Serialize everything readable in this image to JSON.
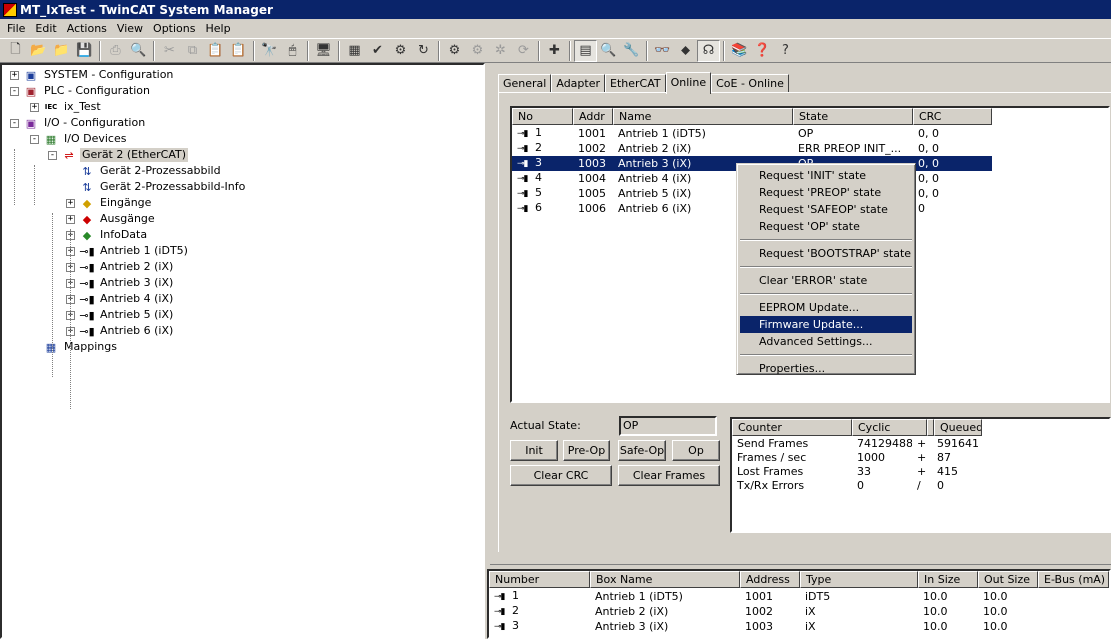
{
  "window": {
    "title": "MT_IxTest - TwinCAT System Manager"
  },
  "menu": [
    "File",
    "Edit",
    "Actions",
    "View",
    "Options",
    "Help"
  ],
  "toolbar": {
    "buttons": [
      {
        "name": "new-file-icon",
        "glyph": "🗋",
        "state": "normal"
      },
      {
        "name": "open-folder-icon",
        "glyph": "📂",
        "state": "normal"
      },
      {
        "name": "open-project-icon",
        "glyph": "📁",
        "state": "normal"
      },
      {
        "name": "save-icon",
        "glyph": "💾",
        "state": "normal"
      },
      {
        "sep": true
      },
      {
        "name": "print-icon",
        "glyph": "⎙",
        "state": "disabled"
      },
      {
        "name": "print-preview-icon",
        "glyph": "🔍",
        "state": "disabled"
      },
      {
        "sep": true
      },
      {
        "name": "cut-icon",
        "glyph": "✂",
        "state": "disabled"
      },
      {
        "name": "copy-icon",
        "glyph": "⧉",
        "state": "disabled"
      },
      {
        "name": "paste-icon",
        "glyph": "📋",
        "state": "disabled"
      },
      {
        "name": "paste-with-links-icon",
        "glyph": "📋",
        "state": "disabled"
      },
      {
        "sep": true
      },
      {
        "name": "find-icon",
        "glyph": "🔭",
        "state": "normal"
      },
      {
        "name": "find-next-icon",
        "glyph": "🖱",
        "state": "normal"
      },
      {
        "sep": true
      },
      {
        "name": "choose-target-icon",
        "glyph": "🖥",
        "state": "normal"
      },
      {
        "sep": true
      },
      {
        "name": "generate-mappings-icon",
        "glyph": "▦",
        "state": "normal"
      },
      {
        "name": "check-configuration-icon",
        "glyph": "✔",
        "state": "normal"
      },
      {
        "name": "activate-configuration-icon",
        "glyph": "⚙",
        "state": "normal"
      },
      {
        "name": "restart-icon",
        "glyph": "↻",
        "state": "normal"
      },
      {
        "sep": true
      },
      {
        "name": "config-mode-icon",
        "glyph": "⚙",
        "state": "normal"
      },
      {
        "name": "free-run-icon",
        "glyph": "⚙",
        "state": "disabled"
      },
      {
        "name": "toggle-run-icon",
        "glyph": "✲",
        "state": "disabled"
      },
      {
        "name": "reload-devices-icon",
        "glyph": "⟳",
        "state": "disabled"
      },
      {
        "sep": true
      },
      {
        "name": "scan-devices-icon",
        "glyph": "✚",
        "state": "normal"
      },
      {
        "sep": true
      },
      {
        "name": "show-online-data-icon",
        "glyph": "▤",
        "state": "pressed"
      },
      {
        "name": "zoom-icon",
        "glyph": "🔍",
        "state": "normal"
      },
      {
        "name": "scope-view-icon",
        "glyph": "🔧",
        "state": "normal"
      },
      {
        "sep": true
      },
      {
        "name": "watch-icon",
        "glyph": "👓",
        "state": "normal"
      },
      {
        "name": "force-icon",
        "glyph": "⬥",
        "state": "normal"
      },
      {
        "name": "online-watch-icon",
        "glyph": "☊",
        "state": "pressed"
      },
      {
        "sep": true
      },
      {
        "name": "books-icon",
        "glyph": "📚",
        "state": "normal"
      },
      {
        "name": "help-topics-icon",
        "glyph": "❓",
        "state": "normal"
      },
      {
        "name": "context-help-icon",
        "glyph": "?",
        "state": "normal"
      }
    ]
  },
  "tree": {
    "nodes": [
      {
        "label": "SYSTEM - Configuration",
        "level": 0,
        "expander": "+",
        "icon": "system-config-icon",
        "glyph": "▣",
        "color": "#1a3c9a"
      },
      {
        "label": "PLC - Configuration",
        "level": 0,
        "expander": "-",
        "icon": "plc-config-icon",
        "glyph": "▣",
        "color": "#a0222e"
      },
      {
        "label": "ix_Test",
        "level": 1,
        "expander": "+",
        "icon": "iec-project-icon",
        "glyph": "IEC",
        "color": "#000"
      },
      {
        "label": "I/O - Configuration",
        "level": 0,
        "expander": "-",
        "icon": "io-config-icon",
        "glyph": "▣",
        "color": "#7a2a9a"
      },
      {
        "label": "I/O Devices",
        "level": 1,
        "expander": "-",
        "icon": "io-devices-icon",
        "glyph": "▦",
        "color": "#2a7a2a"
      },
      {
        "label": "Gerät 2 (EtherCAT)",
        "level": 2,
        "expander": "-",
        "icon": "ethercat-device-icon",
        "glyph": "⇌",
        "color": "#c00",
        "selected": true
      },
      {
        "label": "Gerät 2-Prozessabbild",
        "level": 3,
        "expander": "",
        "icon": "process-image-icon",
        "glyph": "⇅",
        "color": "#1a3c9a"
      },
      {
        "label": "Gerät 2-Prozessabbild-Info",
        "level": 3,
        "expander": "",
        "icon": "process-image-info-icon",
        "glyph": "⇅",
        "color": "#1a3c9a"
      },
      {
        "label": "Eingänge",
        "level": 3,
        "expander": "+",
        "icon": "inputs-icon",
        "glyph": "◆",
        "color": "#d0a000"
      },
      {
        "label": "Ausgänge",
        "level": 3,
        "expander": "+",
        "icon": "outputs-icon",
        "glyph": "◆",
        "color": "#c00"
      },
      {
        "label": "InfoData",
        "level": 3,
        "expander": "+",
        "icon": "infodata-icon",
        "glyph": "◆",
        "color": "#2a8a2a"
      },
      {
        "label": "Antrieb 1 (iDT5)",
        "level": 3,
        "expander": "+",
        "icon": "drive-icon",
        "glyph": "⊸▮",
        "color": "#000"
      },
      {
        "label": "Antrieb 2 (iX)",
        "level": 3,
        "expander": "+",
        "icon": "drive-icon",
        "glyph": "⊸▮",
        "color": "#000"
      },
      {
        "label": "Antrieb 3 (iX)",
        "level": 3,
        "expander": "+",
        "icon": "drive-icon",
        "glyph": "⊸▮",
        "color": "#000"
      },
      {
        "label": "Antrieb 4 (iX)",
        "level": 3,
        "expander": "+",
        "icon": "drive-icon",
        "glyph": "⊸▮",
        "color": "#000"
      },
      {
        "label": "Antrieb 5 (iX)",
        "level": 3,
        "expander": "+",
        "icon": "drive-icon",
        "glyph": "⊸▮",
        "color": "#000"
      },
      {
        "label": "Antrieb 6 (iX)",
        "level": 3,
        "expander": "+",
        "icon": "drive-icon",
        "glyph": "⊸▮",
        "color": "#000"
      },
      {
        "label": "Mappings",
        "level": 1,
        "expander": "",
        "icon": "mappings-icon",
        "glyph": "▦",
        "color": "#1a3c9a"
      }
    ]
  },
  "tabs": [
    {
      "label": "General",
      "active": false
    },
    {
      "label": "Adapter",
      "active": false
    },
    {
      "label": "EtherCAT",
      "active": false
    },
    {
      "label": "Online",
      "active": true
    },
    {
      "label": "CoE - Online",
      "active": false
    }
  ],
  "slaves": {
    "columns": [
      "No",
      "Addr",
      "Name",
      "State",
      "CRC"
    ],
    "rows": [
      {
        "no": "1",
        "addr": "1001",
        "name": "Antrieb 1 (iDT5)",
        "state": "OP",
        "crc": "0, 0",
        "selected": false
      },
      {
        "no": "2",
        "addr": "1002",
        "name": "Antrieb 2 (iX)",
        "state": "ERR PREOP INIT_...",
        "crc": "0, 0",
        "selected": false
      },
      {
        "no": "3",
        "addr": "1003",
        "name": "Antrieb 3 (iX)",
        "state": "OP",
        "crc": "0, 0",
        "selected": true
      },
      {
        "no": "4",
        "addr": "1004",
        "name": "Antrieb 4 (iX)",
        "state": "",
        "crc": "0, 0",
        "selected": false
      },
      {
        "no": "5",
        "addr": "1005",
        "name": "Antrieb 5 (iX)",
        "state": "",
        "crc": "0, 0",
        "selected": false
      },
      {
        "no": "6",
        "addr": "1006",
        "name": "Antrieb 6 (iX)",
        "state": "",
        "crc": "0",
        "selected": false
      }
    ]
  },
  "context_menu": {
    "items": [
      {
        "label": "Request 'INIT' state"
      },
      {
        "label": "Request 'PREOP' state"
      },
      {
        "label": "Request 'SAFEOP' state"
      },
      {
        "label": "Request 'OP' state"
      },
      {
        "sep": true
      },
      {
        "label": "Request 'BOOTSTRAP' state"
      },
      {
        "sep": true
      },
      {
        "label": "Clear 'ERROR' state"
      },
      {
        "sep": true
      },
      {
        "label": "EEPROM Update..."
      },
      {
        "label": "Firmware Update...",
        "highlight": true
      },
      {
        "label": "Advanced Settings..."
      },
      {
        "sep": true
      },
      {
        "label": "Properties..."
      }
    ]
  },
  "state_panel": {
    "actual_state_label": "Actual State:",
    "actual_state_value": "OP",
    "buttons": {
      "init": "Init",
      "preop": "Pre-Op",
      "safeop": "Safe-Op",
      "op": "Op",
      "clear_crc": "Clear CRC",
      "clear_frames": "Clear Frames"
    }
  },
  "counters": {
    "columns": [
      "Counter",
      "Cyclic",
      "",
      "Queued"
    ],
    "rows": [
      {
        "counter": "Send Frames",
        "cyclic": "74129488",
        "op": "+",
        "queued": "591641"
      },
      {
        "counter": "Frames / sec",
        "cyclic": "1000",
        "op": "+",
        "queued": "87"
      },
      {
        "counter": "Lost Frames",
        "cyclic": "33",
        "op": "+",
        "queued": "415"
      },
      {
        "counter": "Tx/Rx Errors",
        "cyclic": "0",
        "op": "/",
        "queued": "0"
      }
    ]
  },
  "boxes": {
    "columns": [
      "Number",
      "Box Name",
      "Address",
      "Type",
      "In Size",
      "Out Size",
      "E-Bus (mA)"
    ],
    "rows": [
      {
        "number": "1",
        "name": "Antrieb 1 (iDT5)",
        "address": "1001",
        "type": "iDT5",
        "in": "10.0",
        "out": "10.0",
        "ebus": ""
      },
      {
        "number": "2",
        "name": "Antrieb 2 (iX)",
        "address": "1002",
        "type": "iX",
        "in": "10.0",
        "out": "10.0",
        "ebus": ""
      },
      {
        "number": "3",
        "name": "Antrieb 3 (iX)",
        "address": "1003",
        "type": "iX",
        "in": "10.0",
        "out": "10.0",
        "ebus": ""
      }
    ]
  }
}
